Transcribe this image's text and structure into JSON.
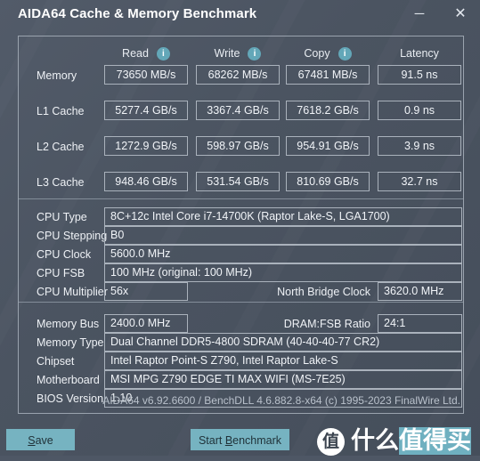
{
  "window": {
    "title": "AIDA64 Cache & Memory Benchmark",
    "minimize_label": "─",
    "close_label": "✕"
  },
  "benchmark_table": {
    "columns": [
      {
        "label": "Read",
        "info_icon": "info-icon",
        "has_info": true
      },
      {
        "label": "Write",
        "info_icon": "info-icon",
        "has_info": true
      },
      {
        "label": "Copy",
        "info_icon": "info-icon",
        "has_info": true
      },
      {
        "label": "Latency",
        "has_info": false
      }
    ],
    "rows": [
      {
        "label": "Memory",
        "read": "73650 MB/s",
        "write": "68262 MB/s",
        "copy": "67481 MB/s",
        "latency": "91.5 ns"
      },
      {
        "label": "L1 Cache",
        "read": "5277.4 GB/s",
        "write": "3367.4 GB/s",
        "copy": "7618.2 GB/s",
        "latency": "0.9 ns"
      },
      {
        "label": "L2 Cache",
        "read": "1272.9 GB/s",
        "write": "598.97 GB/s",
        "copy": "954.91 GB/s",
        "latency": "3.9 ns"
      },
      {
        "label": "L3 Cache",
        "read": "948.46 GB/s",
        "write": "531.54 GB/s",
        "copy": "810.69 GB/s",
        "latency": "32.7 ns"
      }
    ]
  },
  "cpu_info": {
    "cpu_type_label": "CPU Type",
    "cpu_type_value": "8C+12c Intel Core i7-14700K  (Raptor Lake-S, LGA1700)",
    "cpu_stepping_label": "CPU Stepping",
    "cpu_stepping_value": "B0",
    "cpu_clock_label": "CPU Clock",
    "cpu_clock_value": "5600.0 MHz",
    "cpu_fsb_label": "CPU FSB",
    "cpu_fsb_value": "100 MHz  (original: 100 MHz)",
    "cpu_multiplier_label": "CPU Multiplier",
    "cpu_multiplier_value": "56x",
    "north_bridge_clock_label": "North Bridge Clock",
    "north_bridge_clock_value": "3620.0 MHz"
  },
  "memory_info": {
    "memory_bus_label": "Memory Bus",
    "memory_bus_value": "2400.0 MHz",
    "dram_fsb_ratio_label": "DRAM:FSB Ratio",
    "dram_fsb_ratio_value": "24:1",
    "memory_type_label": "Memory Type",
    "memory_type_value": "Dual Channel DDR5-4800 SDRAM  (40-40-40-77 CR2)",
    "chipset_label": "Chipset",
    "chipset_value": "Intel Raptor Point-S Z790, Intel Raptor Lake-S",
    "motherboard_label": "Motherboard",
    "motherboard_value": "MSI MPG Z790 EDGE TI MAX WIFI (MS-7E25)",
    "bios_version_label": "BIOS Version",
    "bios_version_value": "1.10"
  },
  "footer": {
    "version_text": "AIDA64 v6.92.6600 / BenchDLL 4.6.882.8-x64  (c) 1995-2023 FinalWire Ltd.",
    "save_button": {
      "prefix": "",
      "accel": "S",
      "suffix": "ave"
    },
    "benchmark_button": {
      "prefix": "Start ",
      "accel": "B",
      "suffix": "enchmark"
    }
  },
  "watermark": {
    "logo_glyph": "值",
    "text_plain": "什么",
    "text_highlight": "值得买"
  },
  "colors": {
    "accent": "#76b3c1",
    "info_icon": "#63a7b8",
    "window_bg": "#4b5461",
    "border": "#9aa3ae",
    "text": "#e9edf2"
  }
}
